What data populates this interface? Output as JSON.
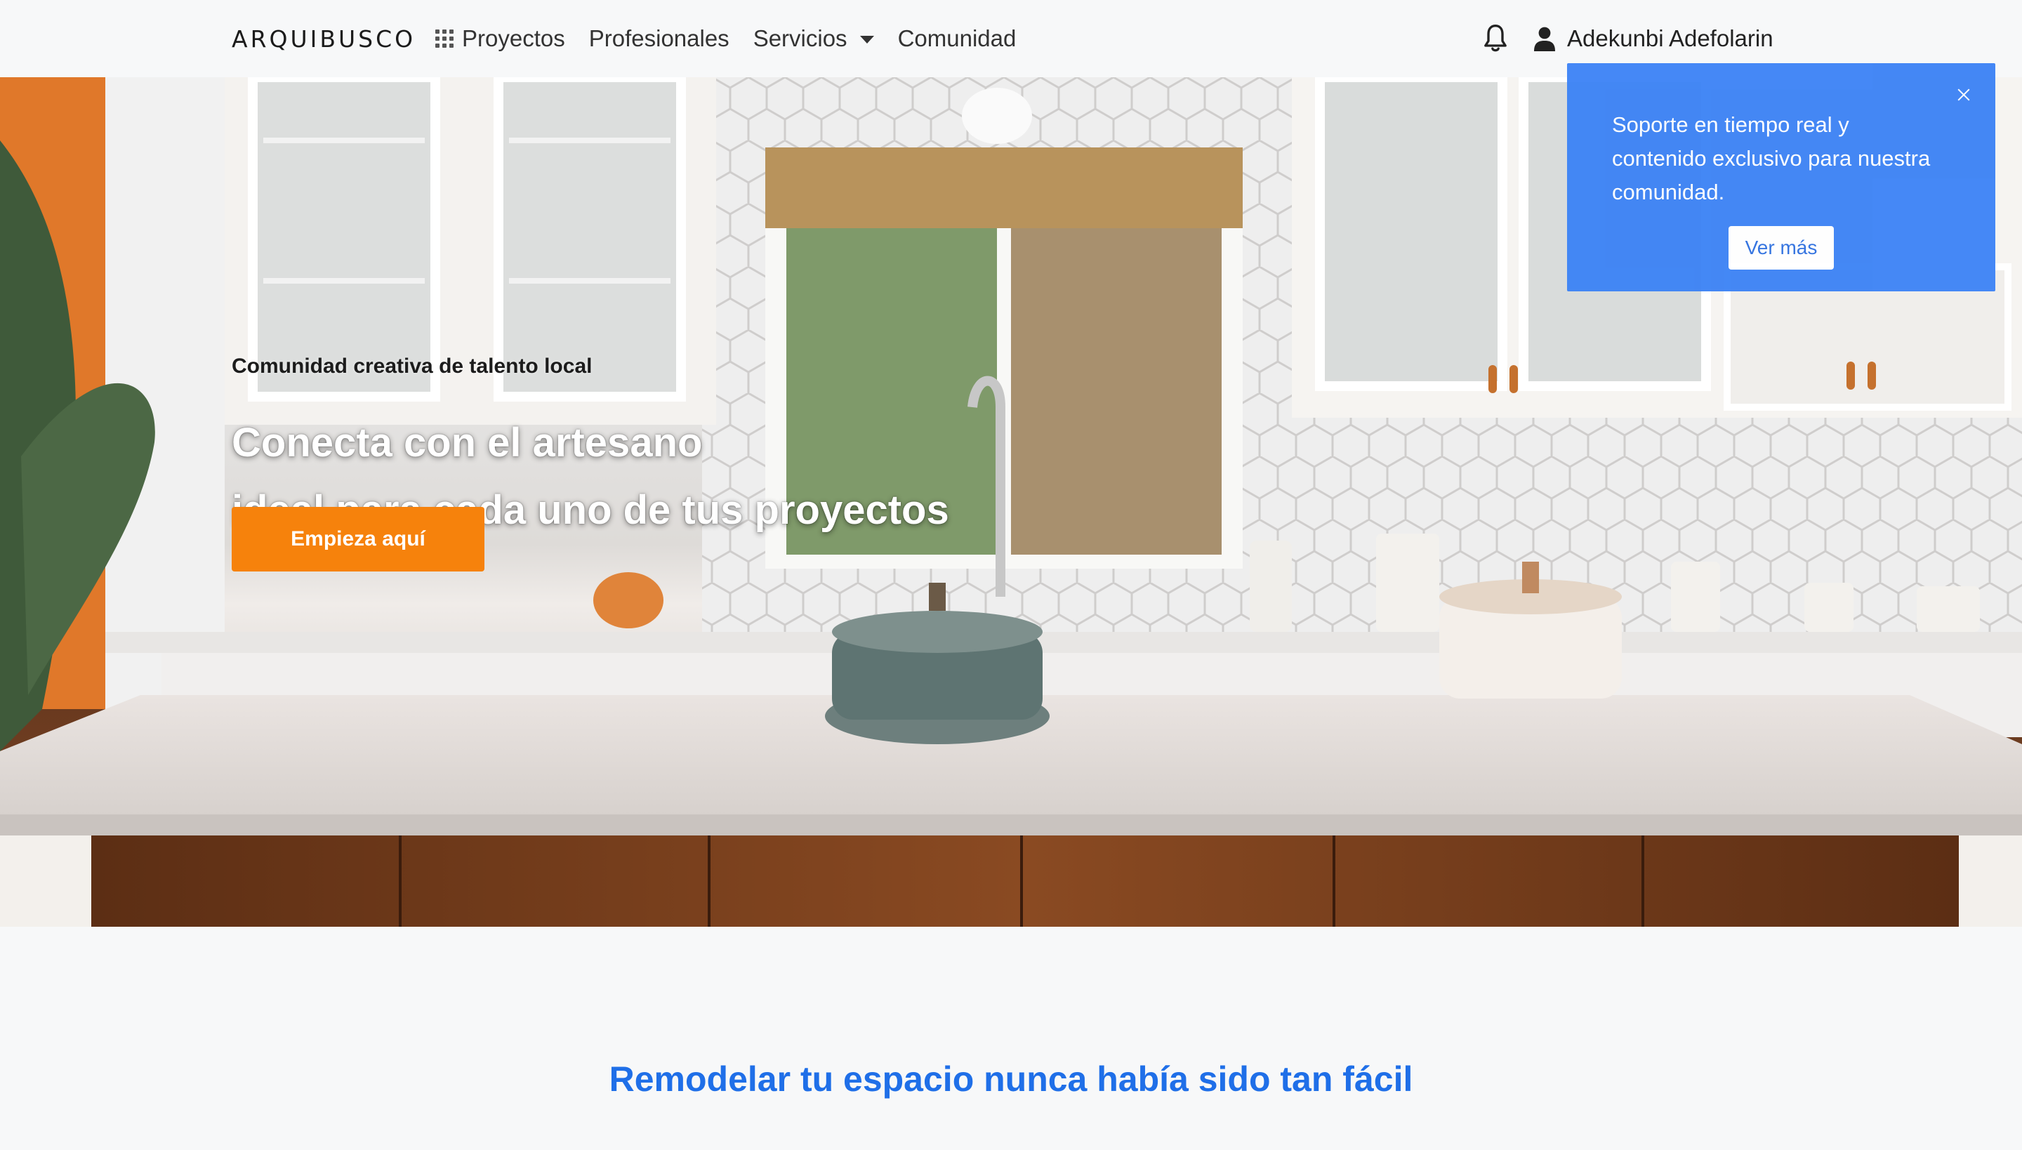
{
  "navbar": {
    "logo": "ARQUIBUSCO",
    "links": [
      {
        "label": "Proyectos",
        "icon": "grid-icon"
      },
      {
        "label": "Profesionales"
      },
      {
        "label": "Servicios",
        "icon": "caret-down-icon"
      },
      {
        "label": "Comunidad"
      }
    ],
    "notifications_icon": "bell-icon",
    "user_name": "Adekunbi Adefolarin",
    "user_icon": "user-icon"
  },
  "hero": {
    "eyebrow": "Comunidad creativa de talento local",
    "headline_line1": "Conecta con el artesano",
    "headline_line2": "ideal para cada uno de tus proyectos",
    "cta_label": "Empieza aquí"
  },
  "popup": {
    "text": "Soporte en tiempo real y contenido exclusivo para nuestra comunidad.",
    "button_label": "Ver más",
    "close_icon": "close-icon"
  },
  "section": {
    "title": "Remodelar tu espacio nunca había sido tan fácil"
  },
  "colors": {
    "accent_orange": "#f6820c",
    "brand_blue": "#1f6fe8",
    "popup_blue": "#3b82f5"
  }
}
